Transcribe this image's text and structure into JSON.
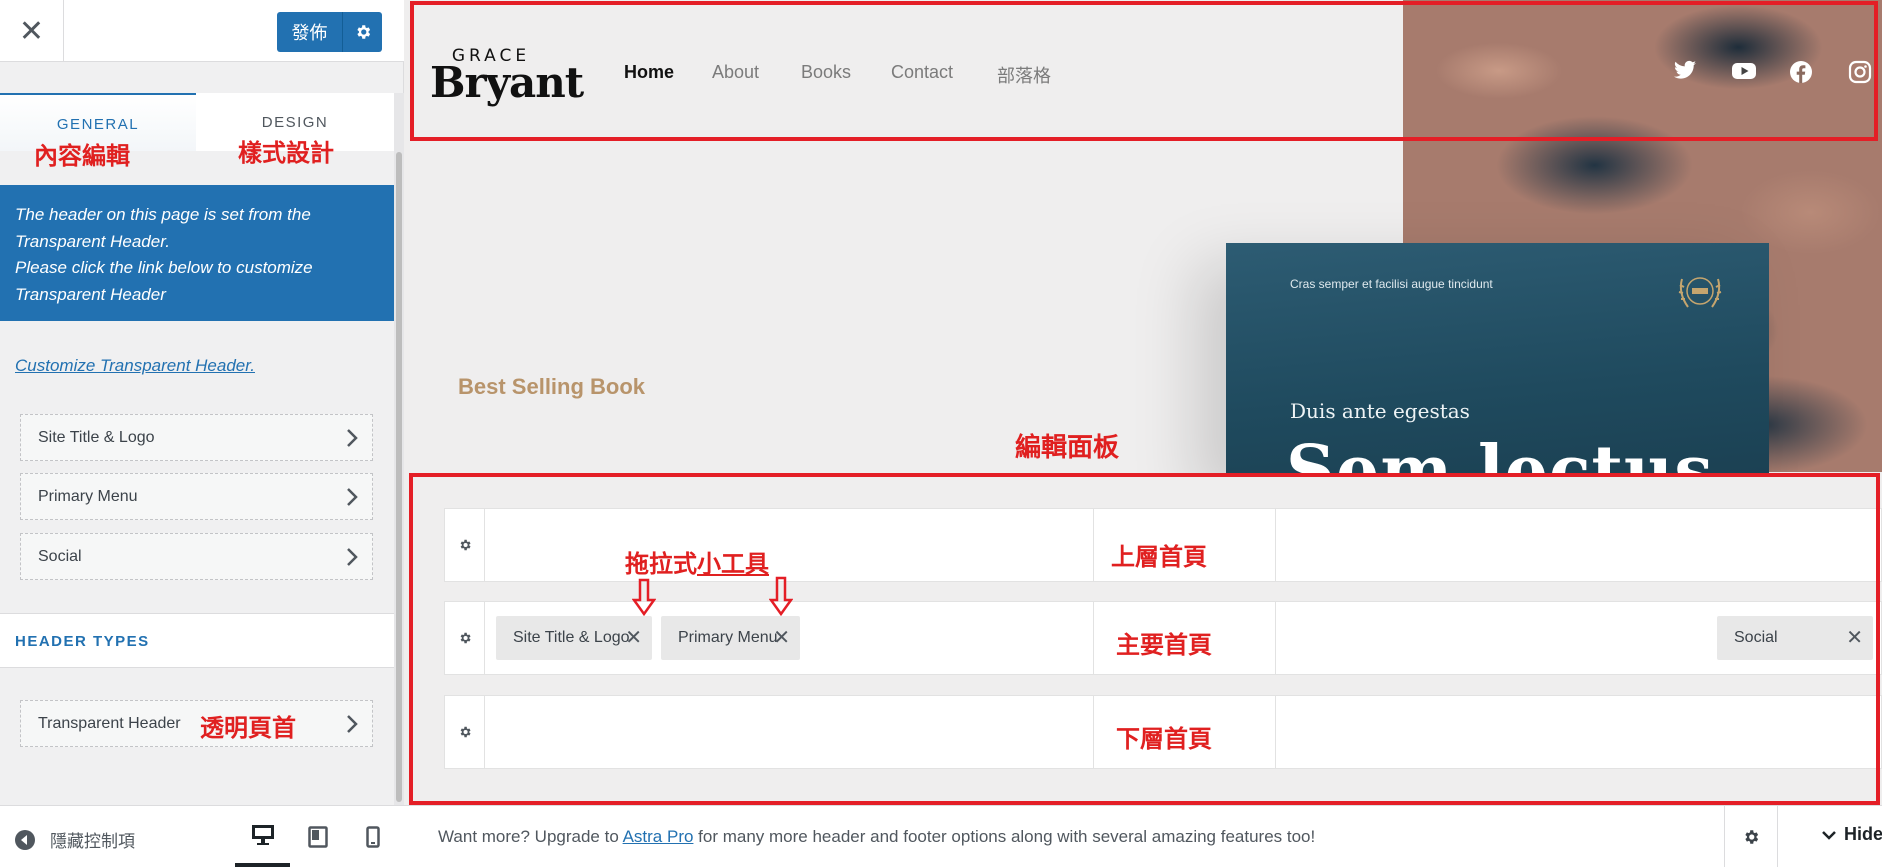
{
  "sidebar": {
    "close_glyph": "✕",
    "publish_label": "發佈",
    "tabs": {
      "general": "GENERAL",
      "design": "DESIGN"
    },
    "tab_annotations": {
      "general": "內容編輯",
      "design": "樣式設計"
    },
    "notice": {
      "line1": "The header on this page is set from the Transparent Header.",
      "line2": "Please click the link below to customize Transparent Header"
    },
    "customize_link": "Customize Transparent Header.",
    "items": [
      {
        "label": "Site Title & Logo"
      },
      {
        "label": "Primary Menu"
      },
      {
        "label": "Social"
      }
    ],
    "header_types_title": "HEADER TYPES",
    "transparent_header": {
      "label": "Transparent Header",
      "annotation": "透明頁首"
    },
    "footer": {
      "collapse_label": "隱藏控制項"
    }
  },
  "preview": {
    "logo": {
      "top": "GRACE",
      "bottom": "Bryant"
    },
    "nav": [
      "Home",
      "About",
      "Books",
      "Contact",
      "部落格"
    ],
    "social_icons": [
      "twitter-icon",
      "youtube-icon",
      "facebook-icon",
      "instagram-icon"
    ],
    "best_selling": "Best Selling Book",
    "book": {
      "tag": "Cras semper et facilisi augue tincidunt",
      "subtitle": "Duis ante egestas",
      "title": "Sem lectus"
    }
  },
  "annotations": {
    "editor_panel": "編輯面板",
    "drag_widgets_part1": "拖拉式",
    "drag_widgets_part2": "小工具",
    "rows": [
      "上層首頁",
      "主要首頁",
      "下層首頁"
    ]
  },
  "builder": {
    "chips": [
      {
        "label": "Site Title & Logo",
        "close": "✕"
      },
      {
        "label": "Primary Menu",
        "close": "✕"
      },
      {
        "label": "Social",
        "close": "✕"
      }
    ]
  },
  "footer_bar": {
    "text_before": "Want more? Upgrade to ",
    "link": "Astra Pro",
    "text_after": " for many more header and footer options along with several amazing features too!",
    "hide_label": "Hide"
  },
  "colors": {
    "accent": "#2271b1",
    "annotation_red": "#e41e26",
    "publish_bg": "#2271b1"
  }
}
